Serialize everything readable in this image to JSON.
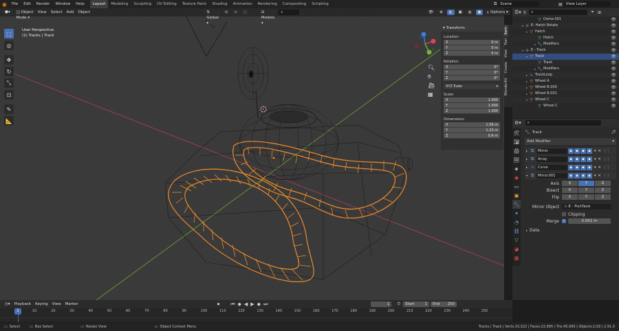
{
  "menu": [
    "File",
    "Edit",
    "Render",
    "Window",
    "Help"
  ],
  "workspaces": [
    {
      "label": "Layout",
      "active": true
    },
    {
      "label": "Modeling"
    },
    {
      "label": "Sculpting"
    },
    {
      "label": "UV Editing"
    },
    {
      "label": "Texture Paint"
    },
    {
      "label": "Shading"
    },
    {
      "label": "Animation"
    },
    {
      "label": "Rendering"
    },
    {
      "label": "Compositing"
    },
    {
      "label": "Scripting"
    }
  ],
  "scene": "Scene",
  "view_layer": "View Layer",
  "viewport": {
    "mode": "Object Mode",
    "menus": [
      "View",
      "Select",
      "Add",
      "Object"
    ],
    "orientation": "Global",
    "collection": "Models",
    "options": "Options",
    "info_line1": "User Perspective",
    "info_line2": "(1) Tracks | Track"
  },
  "npanel": {
    "title": "Transform",
    "location_label": "Location:",
    "location": [
      {
        "axis": "X",
        "value": "0 m"
      },
      {
        "axis": "Y",
        "value": "0 m"
      },
      {
        "axis": "Z",
        "value": "0 m"
      }
    ],
    "rotation_label": "Rotation:",
    "rotation": [
      {
        "axis": "X",
        "value": "0°"
      },
      {
        "axis": "Y",
        "value": "0°"
      },
      {
        "axis": "Z",
        "value": "0°"
      }
    ],
    "rotation_mode": "XYZ Euler",
    "scale_label": "Scale:",
    "scale": [
      {
        "axis": "X",
        "value": "1.000"
      },
      {
        "axis": "Y",
        "value": "1.000"
      },
      {
        "axis": "Z",
        "value": "1.000"
      }
    ],
    "dimensions_label": "Dimensions:",
    "dimensions": [
      {
        "axis": "X",
        "value": "1.56 m"
      },
      {
        "axis": "Y",
        "value": "1.23 m"
      },
      {
        "axis": "Z",
        "value": "0.6 m"
      }
    ]
  },
  "vtabs": [
    "Item",
    "Tool",
    "View",
    "Create",
    "BlenderKit"
  ],
  "outliner": [
    {
      "label": "Dome.001",
      "indent": 5,
      "icon": "mesh",
      "color": "#6fc3a0"
    },
    {
      "label": "E- Hatch Rotate",
      "indent": 2,
      "icon": "empty",
      "color": "#d0d0d0",
      "tri": "▾"
    },
    {
      "label": "Hatch",
      "indent": 3,
      "icon": "object",
      "color": "#f0a040",
      "tri": "▾"
    },
    {
      "label": "Hatch",
      "indent": 5,
      "icon": "mesh",
      "color": "#6fc3a0"
    },
    {
      "label": "Modifiers",
      "indent": 5,
      "icon": "wrench",
      "color": "#6aa0e0",
      "tri": "▸"
    },
    {
      "label": "E - Track",
      "indent": 2,
      "icon": "empty",
      "color": "#d0d0d0",
      "tri": "▾"
    },
    {
      "label": "Track",
      "indent": 3,
      "icon": "object",
      "color": "#f0a040",
      "tri": "▾",
      "selected": true
    },
    {
      "label": "Track",
      "indent": 5,
      "icon": "mesh",
      "color": "#6fc3a0"
    },
    {
      "label": "Modifiers",
      "indent": 5,
      "icon": "wrench",
      "color": "#6aa0e0",
      "tri": "▸"
    },
    {
      "label": "TrackLoop",
      "indent": 3,
      "icon": "curve",
      "color": "#6aa0e0",
      "tri": "▸"
    },
    {
      "label": "Wheel A",
      "indent": 3,
      "icon": "object",
      "color": "#f0a040",
      "tri": "▸"
    },
    {
      "label": "Wheel B.000",
      "indent": 3,
      "icon": "object",
      "color": "#f0a040",
      "tri": "▸"
    },
    {
      "label": "Wheel B.001",
      "indent": 3,
      "icon": "object",
      "color": "#f0a040",
      "tri": "▸"
    },
    {
      "label": "Wheel C",
      "indent": 3,
      "icon": "object",
      "color": "#f0a040",
      "tri": "▾"
    },
    {
      "label": "Wheel C",
      "indent": 5,
      "icon": "mesh",
      "color": "#6fc3a0"
    }
  ],
  "properties": {
    "object_name": "Track",
    "add_modifier": "Add Modifier",
    "modifiers": [
      "Mirror",
      "Array",
      "Curve",
      "Mirror.001"
    ],
    "axis_label": "Axis",
    "bisect_label": "Bisect",
    "flip_label": "Flip",
    "axes": [
      "X",
      "Y",
      "Z"
    ],
    "mirror_object_label": "Mirror Object",
    "mirror_object": "E - FishTank",
    "clipping": "Clipping",
    "merge_label": "Merge",
    "merge_value": "0.001 m",
    "data_label": "Data"
  },
  "timeline": {
    "menus": [
      "Playback",
      "Keying",
      "View",
      "Marker"
    ],
    "current_frame": "1",
    "start_label": "Start",
    "start": "1",
    "end_label": "End",
    "end": "250",
    "ticks": [
      "10",
      "20",
      "30",
      "40",
      "50",
      "60",
      "70",
      "80",
      "90",
      "100",
      "110",
      "120",
      "130",
      "140",
      "150",
      "160",
      "170",
      "180",
      "190",
      "200",
      "210",
      "220",
      "230",
      "240",
      "250"
    ],
    "cursor": "1"
  },
  "status": {
    "select": "Select",
    "box_select": "Box Select",
    "rotate_view": "Rotate View",
    "context_menu": "Object Context Menu",
    "stats": "Tracks | Track | Verts:23,322 | Faces:22,995 | Tris:45,990 | Objects:1/18 | 2.91.0"
  }
}
